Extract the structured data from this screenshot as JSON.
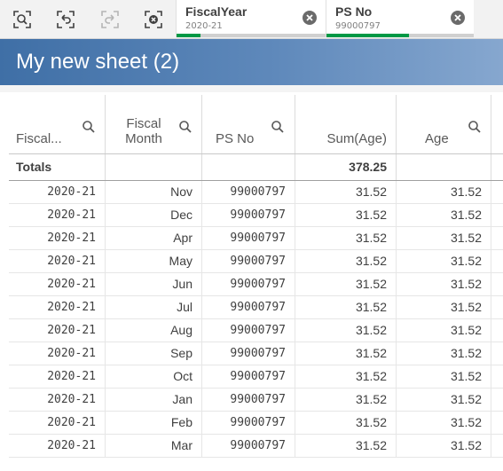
{
  "toolbar": {
    "buttons": [
      "smart-search",
      "step-back",
      "step-forward",
      "clear-selections"
    ]
  },
  "selections": [
    {
      "field": "FiscalYear",
      "value": "2020-21",
      "bar_fraction": 0.16
    },
    {
      "field": "PS No",
      "value": "99000797",
      "bar_fraction": 0.56
    }
  ],
  "sheet": {
    "title": "My new sheet (2)"
  },
  "table": {
    "columns": [
      "Fiscal...",
      "Fiscal Month",
      "PS No",
      "Sum(Age)",
      "Age"
    ],
    "totals": {
      "label": "Totals",
      "sum_age": "378.25"
    },
    "rows": [
      {
        "fy": "2020-21",
        "month": "Nov",
        "ps": "99000797",
        "sum": "31.52",
        "age": "31.52"
      },
      {
        "fy": "2020-21",
        "month": "Dec",
        "ps": "99000797",
        "sum": "31.52",
        "age": "31.52"
      },
      {
        "fy": "2020-21",
        "month": "Apr",
        "ps": "99000797",
        "sum": "31.52",
        "age": "31.52"
      },
      {
        "fy": "2020-21",
        "month": "May",
        "ps": "99000797",
        "sum": "31.52",
        "age": "31.52"
      },
      {
        "fy": "2020-21",
        "month": "Jun",
        "ps": "99000797",
        "sum": "31.52",
        "age": "31.52"
      },
      {
        "fy": "2020-21",
        "month": "Jul",
        "ps": "99000797",
        "sum": "31.52",
        "age": "31.52"
      },
      {
        "fy": "2020-21",
        "month": "Aug",
        "ps": "99000797",
        "sum": "31.52",
        "age": "31.52"
      },
      {
        "fy": "2020-21",
        "month": "Sep",
        "ps": "99000797",
        "sum": "31.52",
        "age": "31.52"
      },
      {
        "fy": "2020-21",
        "month": "Oct",
        "ps": "99000797",
        "sum": "31.52",
        "age": "31.52"
      },
      {
        "fy": "2020-21",
        "month": "Jan",
        "ps": "99000797",
        "sum": "31.52",
        "age": "31.52"
      },
      {
        "fy": "2020-21",
        "month": "Feb",
        "ps": "99000797",
        "sum": "31.52",
        "age": "31.52"
      },
      {
        "fy": "2020-21",
        "month": "Mar",
        "ps": "99000797",
        "sum": "31.52",
        "age": "31.52"
      }
    ]
  },
  "colors": {
    "selection_green": "#009845",
    "header_blue": "#3f6fa6",
    "text": "#404040"
  }
}
